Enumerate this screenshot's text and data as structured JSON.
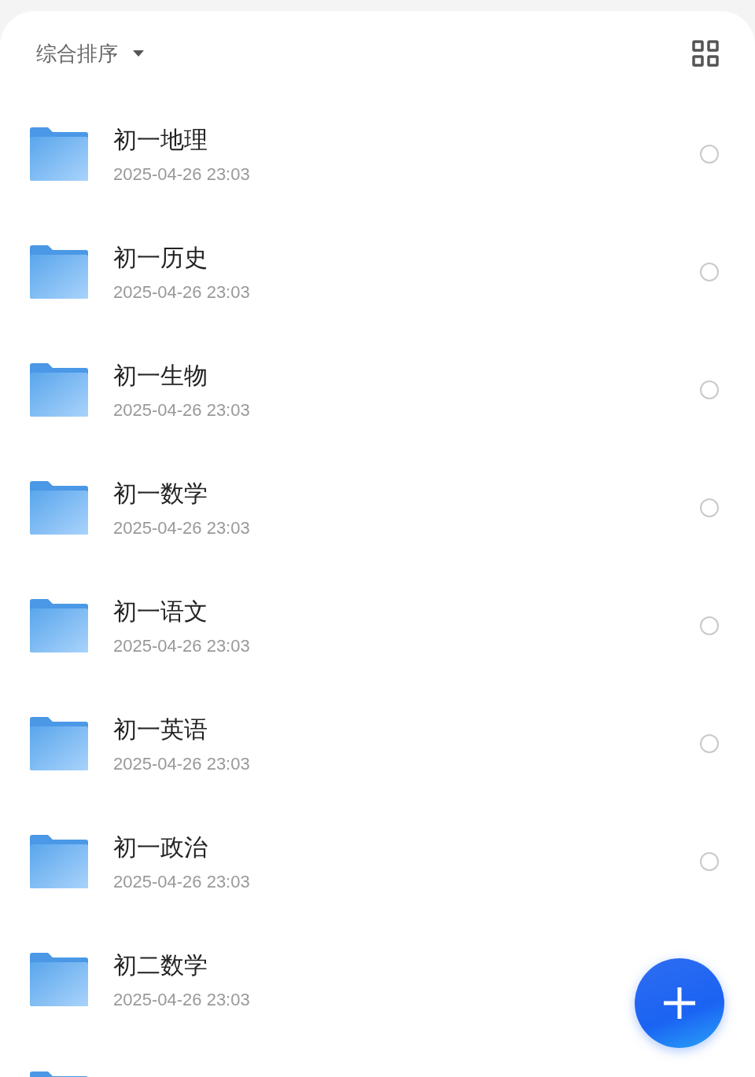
{
  "toolbar": {
    "sort_label": "综合排序"
  },
  "folders": [
    {
      "name": "初一地理",
      "date": "2025-04-26 23:03",
      "selected": false
    },
    {
      "name": "初一历史",
      "date": "2025-04-26 23:03",
      "selected": false
    },
    {
      "name": "初一生物",
      "date": "2025-04-26 23:03",
      "selected": false
    },
    {
      "name": "初一数学",
      "date": "2025-04-26 23:03",
      "selected": false
    },
    {
      "name": "初一语文",
      "date": "2025-04-26 23:03",
      "selected": false
    },
    {
      "name": "初一英语",
      "date": "2025-04-26 23:03",
      "selected": false
    },
    {
      "name": "初一政治",
      "date": "2025-04-26 23:03",
      "selected": false
    },
    {
      "name": "初二数学",
      "date": "2025-04-26 23:03"
    }
  ]
}
